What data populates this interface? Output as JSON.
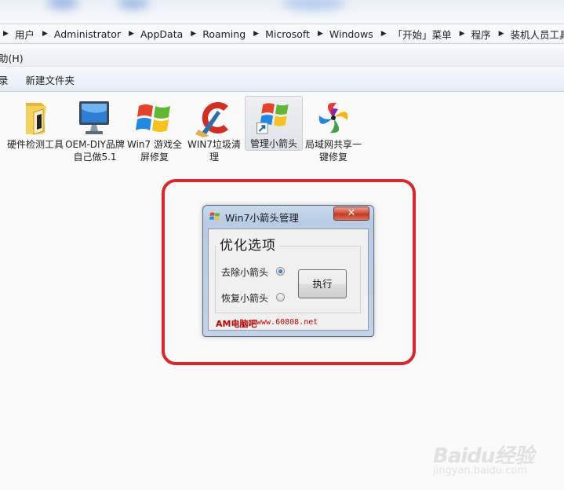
{
  "address_bar": {
    "crumbs": [
      "用户",
      "Administrator",
      "AppData",
      "Roaming",
      "Microsoft",
      "Windows",
      "「开始」菜单",
      "程序",
      "装机人员工具"
    ]
  },
  "menu_bar": {
    "items": [
      "助(H)"
    ]
  },
  "toolbar": {
    "items": [
      "录",
      "新建文件夹"
    ]
  },
  "files": [
    {
      "label": "硬件检测工具",
      "icon": "folder-icon"
    },
    {
      "label": "OEM-DIY品牌自己做5.1",
      "icon": "monitor-icon"
    },
    {
      "label": "Win7 游戏全屏修复",
      "icon": "windows-flag-icon"
    },
    {
      "label": "WIN7垃圾清理",
      "icon": "ccleaner-icon"
    },
    {
      "label": "管理小箭头",
      "icon": "windows-shortcut-icon",
      "selected": true
    },
    {
      "label": "局域网共享一键修复",
      "icon": "network-share-icon"
    }
  ],
  "dialog": {
    "title": "Win7小箭头管理",
    "close_label": "✕",
    "group_title": "优化选项",
    "option_remove": "去除小箭头",
    "option_restore": "恢复小箭头",
    "selected_option": "remove",
    "execute_label": "执行",
    "footer_brand": "AM电脑吧",
    "footer_url": "www.60808.net"
  },
  "watermark": {
    "brand": "Baidu经验",
    "url": "jingyan.baidu.com"
  },
  "colors": {
    "highlight": "#e0242c",
    "footer_text": "#c40000",
    "titlebar": "#b8cce4"
  }
}
